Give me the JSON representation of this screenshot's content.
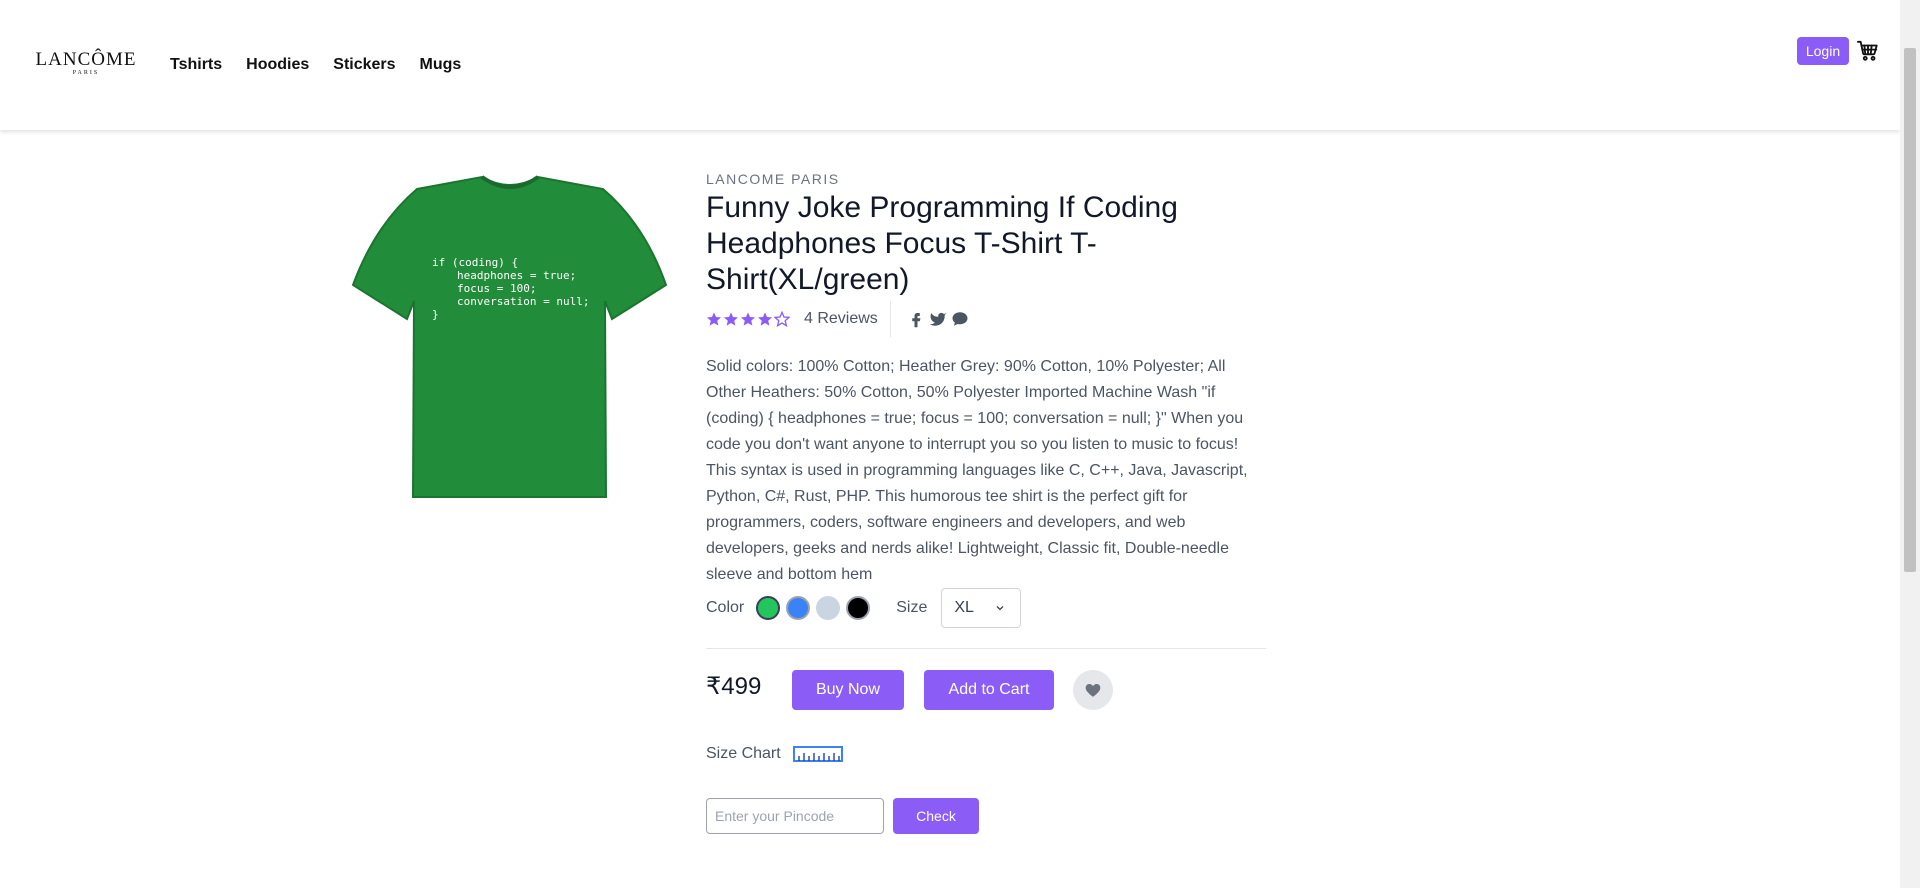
{
  "header": {
    "logo_text": "LANCÔME",
    "logo_sub": "PARIS",
    "nav": [
      {
        "label": "Tshirts"
      },
      {
        "label": "Hoodies"
      },
      {
        "label": "Stickers"
      },
      {
        "label": "Mugs"
      }
    ],
    "login_label": "Login",
    "cart_icon": "cart-icon"
  },
  "product": {
    "brand": "LANCOME PARIS",
    "title": "Funny Joke Programming If Coding Headphones Focus T-Shirt T-Shirt(XL/green)",
    "image_text": [
      "if (coding) {",
      "headphones = true;",
      "focus = 100;",
      "conversation = null;",
      "}"
    ],
    "rating": 4,
    "rating_max": 5,
    "reviews_label": "4 Reviews",
    "social_icons": [
      "facebook-icon",
      "twitter-icon",
      "chat-icon"
    ],
    "description": "Solid colors: 100% Cotton; Heather Grey: 90% Cotton, 10% Polyester; All Other Heathers: 50% Cotton, 50% Polyester Imported Machine Wash \"if (coding) { headphones = true; focus = 100; conversation = null; }\" When you code you don't want anyone to interrupt you so you listen to music to focus! This syntax is used in programming languages like C, C++, Java, Javascript, Python, C#, Rust, PHP. This humorous tee shirt is the perfect gift for programmers, coders, software engineers and developers, and web developers, geeks and nerds alike! Lightweight, Classic fit, Double-needle sleeve and bottom hem",
    "color_label": "Color",
    "colors": [
      "#22c55e",
      "#3b82f6",
      "#cbd5e1",
      "#000000"
    ],
    "size_label": "Size",
    "size_value": "XL",
    "price": "₹499",
    "buy_now_label": "Buy Now",
    "add_to_cart_label": "Add to Cart",
    "size_chart_label": "Size Chart",
    "pincode_placeholder": "Enter your Pincode",
    "check_label": "Check"
  },
  "colors": {
    "accent": "#8b5cf6",
    "shirt": "#218c3a"
  }
}
